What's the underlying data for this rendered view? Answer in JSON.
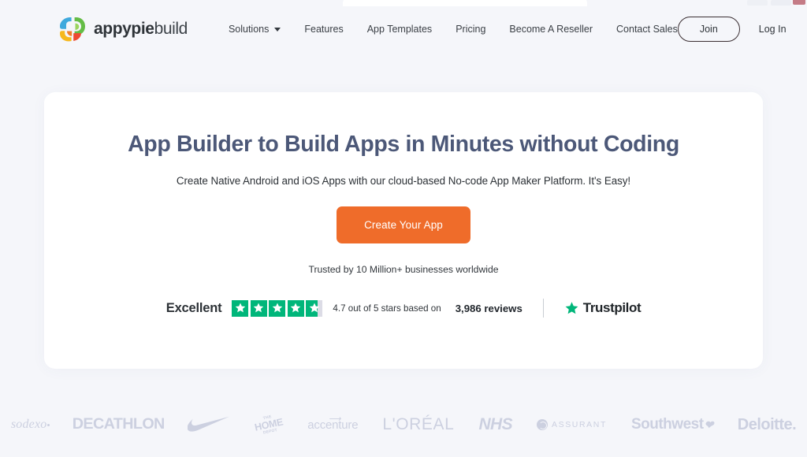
{
  "browser": {
    "window_controls": [
      "minimize",
      "maximize",
      "close"
    ]
  },
  "header": {
    "brand": {
      "logo_icon": "appypie-petal-logo",
      "name_bold": "appypie",
      "name_light": "build"
    },
    "nav": [
      {
        "label": "Solutions",
        "has_dropdown": true,
        "dropdown_icon": "chevron-down-icon"
      },
      {
        "label": "Features",
        "has_dropdown": false
      },
      {
        "label": "App Templates",
        "has_dropdown": false
      },
      {
        "label": "Pricing",
        "has_dropdown": false
      },
      {
        "label": "Become A Reseller",
        "has_dropdown": false
      },
      {
        "label": "Contact Sales",
        "has_dropdown": false
      }
    ],
    "actions": {
      "join_label": "Join",
      "login_label": "Log In"
    }
  },
  "hero": {
    "title": "App Builder to Build Apps in Minutes without Coding",
    "subtitle": "Create Native Android and iOS Apps with our cloud-based No-code App Maker Platform. It's Easy!",
    "cta_label": "Create Your App",
    "trusted_line": "Trusted by 10 Million+ businesses worldwide",
    "rating": {
      "word": "Excellent",
      "score": "4.7",
      "stars_filled": 4.7,
      "stars_total": 5,
      "summary": "4.7 out of 5 stars based on",
      "review_count": "3,986 reviews",
      "provider_name": "Trustpilot",
      "provider_icon": "trustpilot-star-icon",
      "star_color": "#00b67a",
      "star_empty_color": "#dcdce6"
    }
  },
  "brand_strip": {
    "logos": [
      {
        "name": "sodexo",
        "label": "sodexo"
      },
      {
        "name": "decathlon",
        "label": "DECATHLON"
      },
      {
        "name": "nike",
        "label": "Nike"
      },
      {
        "name": "home-depot",
        "label": "THE HOME DEPOT",
        "line1": "THE",
        "line2": "HOME",
        "line3": "DEPOT"
      },
      {
        "name": "accenture",
        "label": "accenture"
      },
      {
        "name": "loreal",
        "label": "L'ORÉAL"
      },
      {
        "name": "nhs",
        "label": "NHS"
      },
      {
        "name": "assurant",
        "label": "ASSURANT"
      },
      {
        "name": "southwest",
        "label": "Southwest"
      },
      {
        "name": "deloitte",
        "label": "Deloitte."
      }
    ]
  },
  "colors": {
    "page_bg": "#f5f6fa",
    "card_bg": "#ffffff",
    "accent_orange": "#ef6c2a",
    "heading_blue": "#4c5878",
    "trustpilot_green": "#00b67a",
    "logo_gray": "#ccd0e0"
  }
}
